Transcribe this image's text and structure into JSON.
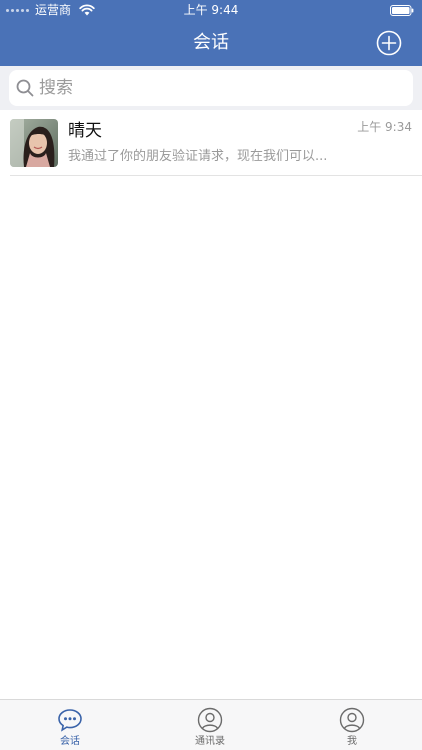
{
  "status_bar": {
    "carrier": "运营商",
    "time": "上午 9:44"
  },
  "nav": {
    "title": "会话",
    "add_icon": "plus-circle-icon"
  },
  "search": {
    "placeholder": "搜索",
    "icon": "search-icon"
  },
  "conversations": [
    {
      "name": "晴天",
      "time": "上午 9:34",
      "preview": "我通过了你的朋友验证请求，现在我们可以..."
    }
  ],
  "tabbar": {
    "tabs": [
      {
        "label": "会话",
        "icon": "chat-bubble-icon",
        "active": true
      },
      {
        "label": "通讯录",
        "icon": "contacts-icon",
        "active": false
      },
      {
        "label": "我",
        "icon": "profile-icon",
        "active": false
      }
    ]
  },
  "colors": {
    "header": "#4a72b7",
    "tab_active": "#3a63a9",
    "search_bg": "#eff0f4"
  }
}
